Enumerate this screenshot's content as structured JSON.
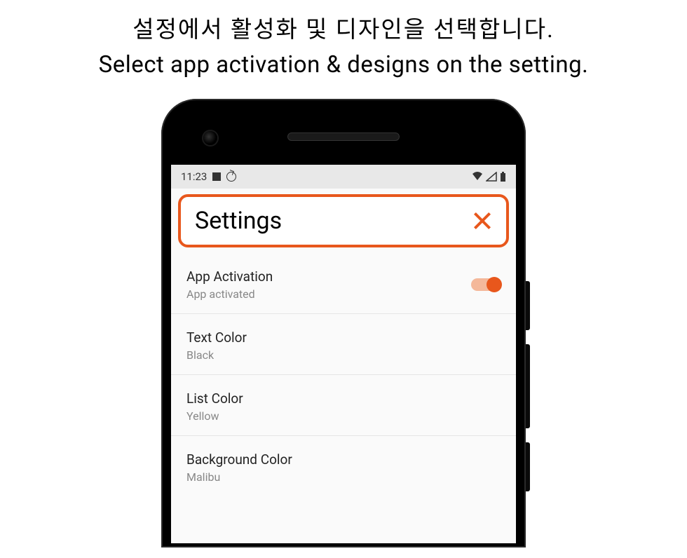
{
  "caption": {
    "ko": "설정에서 활성화 및 디자인을 선택합니다.",
    "en": "Select app activation & designs on the setting."
  },
  "status": {
    "time": "11:23",
    "wifi": "▾",
    "signal": "◿",
    "battery": "▮"
  },
  "header": {
    "title": "Settings",
    "close_label": "X"
  },
  "settings": {
    "activation": {
      "title": "App Activation",
      "sub": "App activated",
      "on": true
    },
    "text_color": {
      "title": "Text Color",
      "sub": "Black"
    },
    "list_color": {
      "title": "List Color",
      "sub": "Yellow"
    },
    "bg_color": {
      "title": "Background Color",
      "sub": "Malibu"
    }
  },
  "colors": {
    "accent": "#e8571c"
  }
}
